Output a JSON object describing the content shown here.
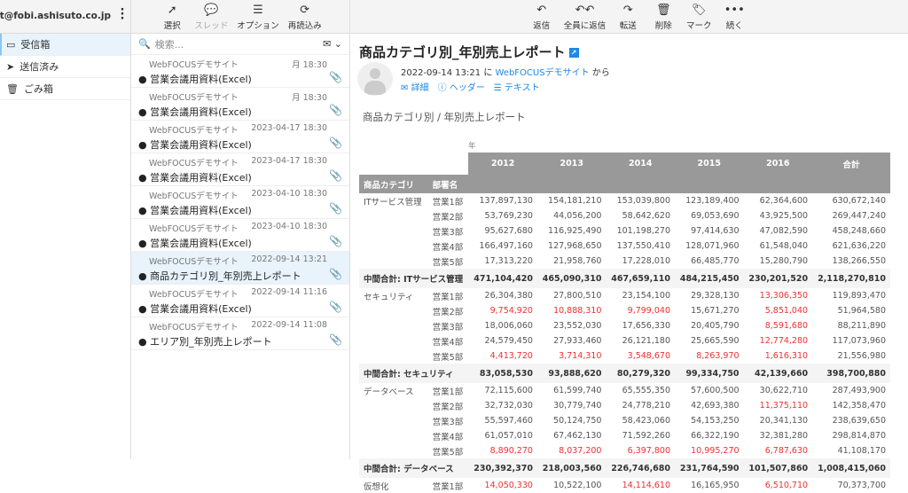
{
  "account": "guest@fobi.ashisuto.co.jp",
  "folders": [
    {
      "label": "受信箱",
      "icon": "inbox-icon"
    },
    {
      "label": "送信済み",
      "icon": "send-icon"
    },
    {
      "label": "ごみ箱",
      "icon": "trash-icon"
    }
  ],
  "list_toolbar": [
    {
      "label": "選択",
      "glyph": "➚"
    },
    {
      "label": "スレッド",
      "glyph": "💬"
    },
    {
      "label": "オプション",
      "glyph": "☰"
    },
    {
      "label": "再読込み",
      "glyph": "⟳"
    }
  ],
  "search": {
    "placeholder": "検索..."
  },
  "messages": [
    {
      "from": "WebFOCUSデモサイト",
      "date": "月 18:30",
      "subject": "営業会議用資料(Excel)"
    },
    {
      "from": "WebFOCUSデモサイト",
      "date": "月 18:30",
      "subject": "営業会議用資料(Excel)"
    },
    {
      "from": "WebFOCUSデモサイト",
      "date": "2023-04-17 18:30",
      "subject": "営業会議用資料(Excel)"
    },
    {
      "from": "WebFOCUSデモサイト",
      "date": "2023-04-17 18:30",
      "subject": "営業会議用資料(Excel)"
    },
    {
      "from": "WebFOCUSデモサイト",
      "date": "2023-04-10 18:30",
      "subject": "営業会議用資料(Excel)"
    },
    {
      "from": "WebFOCUSデモサイト",
      "date": "2023-04-10 18:30",
      "subject": "営業会議用資料(Excel)"
    },
    {
      "from": "WebFOCUSデモサイト",
      "date": "2022-09-14 13:21",
      "subject": "商品カテゴリ別_年別売上レポート",
      "selected": true
    },
    {
      "from": "WebFOCUSデモサイト",
      "date": "2022-09-14 11:16",
      "subject": "営業会議用資料(Excel)"
    },
    {
      "from": "WebFOCUSデモサイト",
      "date": "2022-09-14 11:08",
      "subject": "エリア別_年別売上レポート"
    }
  ],
  "main_toolbar": [
    {
      "label": "返信",
      "glyph": "↶"
    },
    {
      "label": "全員に返信",
      "glyph": "↶↶"
    },
    {
      "label": "転送",
      "glyph": "↷"
    },
    {
      "label": "削除",
      "glyph": "🗑"
    },
    {
      "label": "マーク",
      "glyph": "🏷"
    },
    {
      "label": "続く",
      "glyph": "•••"
    }
  ],
  "message": {
    "title": "商品カテゴリ別_年別売上レポート",
    "datetime": "2022-09-14 13:21",
    "at": "に",
    "sender": "WebFOCUSデモサイト",
    "from_suffix": "から",
    "links": [
      "詳細",
      "ヘッダー",
      "テキスト"
    ],
    "report_title": "商品カテゴリ別 / 年別売上レポート"
  },
  "report": {
    "year_label": "年",
    "years": [
      "2012",
      "2013",
      "2014",
      "2015",
      "2016",
      "合計"
    ],
    "col_headers": [
      "商品カテゴリ",
      "部署名"
    ],
    "groups": [
      {
        "category": "ITサービス管理",
        "rows": [
          {
            "dept": "営業1部",
            "v": [
              "137,897,130",
              "154,181,210",
              "153,039,800",
              "123,189,400",
              "62,364,600",
              "630,672,140"
            ],
            "red": []
          },
          {
            "dept": "営業2部",
            "v": [
              "53,769,230",
              "44,056,200",
              "58,642,620",
              "69,053,690",
              "43,925,500",
              "269,447,240"
            ],
            "red": []
          },
          {
            "dept": "営業3部",
            "v": [
              "95,627,680",
              "116,925,490",
              "101,198,270",
              "97,414,630",
              "47,082,590",
              "458,248,660"
            ],
            "red": []
          },
          {
            "dept": "営業4部",
            "v": [
              "166,497,160",
              "127,968,650",
              "137,550,410",
              "128,071,960",
              "61,548,040",
              "621,636,220"
            ],
            "red": []
          },
          {
            "dept": "営業5部",
            "v": [
              "17,313,220",
              "21,958,760",
              "17,228,010",
              "66,485,770",
              "15,280,790",
              "138,266,550"
            ],
            "red": []
          }
        ],
        "subtotal_label": "中間合計: ITサービス管理",
        "subtotal": [
          "471,104,420",
          "465,090,310",
          "467,659,110",
          "484,215,450",
          "230,201,520",
          "2,118,270,810"
        ]
      },
      {
        "category": "セキュリティ",
        "rows": [
          {
            "dept": "営業1部",
            "v": [
              "26,304,380",
              "27,800,510",
              "23,154,100",
              "29,328,130",
              "13,306,350",
              "119,893,470"
            ],
            "red": [
              4
            ]
          },
          {
            "dept": "営業2部",
            "v": [
              "9,754,920",
              "10,888,310",
              "9,799,040",
              "15,671,270",
              "5,851,040",
              "51,964,580"
            ],
            "red": [
              0,
              1,
              2,
              4
            ]
          },
          {
            "dept": "営業3部",
            "v": [
              "18,006,060",
              "23,552,030",
              "17,656,330",
              "20,405,790",
              "8,591,680",
              "88,211,890"
            ],
            "red": [
              4
            ]
          },
          {
            "dept": "営業4部",
            "v": [
              "24,579,450",
              "27,933,460",
              "26,121,180",
              "25,665,590",
              "12,774,280",
              "117,073,960"
            ],
            "red": [
              4
            ]
          },
          {
            "dept": "営業5部",
            "v": [
              "4,413,720",
              "3,714,310",
              "3,548,670",
              "8,263,970",
              "1,616,310",
              "21,556,980"
            ],
            "red": [
              0,
              1,
              2,
              3,
              4
            ]
          }
        ],
        "subtotal_label": "中間合計: セキュリティ",
        "subtotal": [
          "83,058,530",
          "93,888,620",
          "80,279,320",
          "99,334,750",
          "42,139,660",
          "398,700,880"
        ]
      },
      {
        "category": "データベース",
        "rows": [
          {
            "dept": "営業1部",
            "v": [
              "72,115,600",
              "61,599,740",
              "65,555,350",
              "57,600,500",
              "30,622,710",
              "287,493,900"
            ],
            "red": []
          },
          {
            "dept": "営業2部",
            "v": [
              "32,732,030",
              "30,779,740",
              "24,778,210",
              "42,693,380",
              "11,375,110",
              "142,358,470"
            ],
            "red": [
              4
            ]
          },
          {
            "dept": "営業3部",
            "v": [
              "55,597,460",
              "50,124,750",
              "58,423,060",
              "54,153,250",
              "20,341,130",
              "238,639,650"
            ],
            "red": []
          },
          {
            "dept": "営業4部",
            "v": [
              "61,057,010",
              "67,462,130",
              "71,592,260",
              "66,322,190",
              "32,381,280",
              "298,814,870"
            ],
            "red": []
          },
          {
            "dept": "営業5部",
            "v": [
              "8,890,270",
              "8,037,200",
              "6,397,800",
              "10,995,270",
              "6,787,630",
              "41,108,170"
            ],
            "red": [
              0,
              1,
              2,
              3,
              4
            ]
          }
        ],
        "subtotal_label": "中間合計: データベース",
        "subtotal": [
          "230,392,370",
          "218,003,560",
          "226,746,680",
          "231,764,590",
          "101,507,860",
          "1,008,415,060"
        ]
      },
      {
        "category": "仮想化",
        "rows": [
          {
            "dept": "営業1部",
            "v": [
              "14,050,330",
              "10,522,100",
              "14,114,610",
              "16,165,950",
              "6,510,710",
              "70,373,700"
            ],
            "red": [
              0,
              2,
              4
            ]
          }
        ]
      }
    ]
  },
  "colors": {
    "accent": "#1e88e5",
    "red": "#f03030",
    "header": "#999999"
  }
}
